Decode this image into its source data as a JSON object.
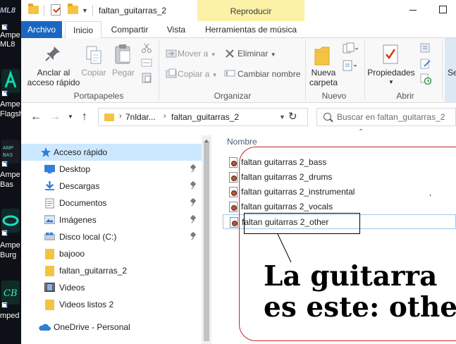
{
  "desktop": {
    "tiles": [
      {
        "label_top": "ML8",
        "label": "Ampe",
        "label2": "ML8",
        "color": "#3a3f52"
      },
      {
        "label": "Ampe",
        "label2": "Flagsh",
        "color": "#0e2a26"
      },
      {
        "label": "Ampe",
        "label2": "Bas",
        "color": "#1a1a22"
      },
      {
        "label": "Ampe",
        "label2": "Burg",
        "color": "#0f2b2a"
      },
      {
        "label": "mped",
        "label2": "",
        "color": "#0f2b26"
      }
    ]
  },
  "window": {
    "title": "faltan_guitarras_2",
    "context_tab": "Reproducir",
    "tabs": {
      "archivo": "Archivo",
      "inicio": "Inicio",
      "compartir": "Compartir",
      "vista": "Vista",
      "herramientas": "Herramientas de música"
    }
  },
  "ribbon": {
    "portapapeles": {
      "label": "Portapapeles",
      "anclar": "Anclar al",
      "anclar2": "acceso rápido",
      "copiar": "Copiar",
      "pegar": "Pegar"
    },
    "organizar": {
      "label": "Organizar",
      "mover": "Mover a",
      "copiar_a": "Copiar a",
      "eliminar": "Eliminar",
      "cambiar": "Cambiar nombre"
    },
    "nuevo": {
      "label": "Nuevo",
      "nueva": "Nueva",
      "carpeta": "carpeta"
    },
    "abrir": {
      "label": "Abrir",
      "propiedades": "Propiedades"
    },
    "cut_label": "Se"
  },
  "address": {
    "parts": [
      "7nldar...",
      "faltan_guitarras_2"
    ],
    "search_placeholder": "Buscar en faltan_guitarras_2"
  },
  "nav": {
    "items": [
      {
        "label": "Acceso rápido",
        "icon": "star-icon",
        "selected": true,
        "pinned": false
      },
      {
        "label": "Desktop",
        "icon": "desktop-icon",
        "pinned": true
      },
      {
        "label": "Descargas",
        "icon": "download-icon",
        "pinned": true
      },
      {
        "label": "Documentos",
        "icon": "document-icon",
        "pinned": true
      },
      {
        "label": "Imágenes",
        "icon": "image-icon",
        "pinned": true
      },
      {
        "label": "Disco local (C:)",
        "icon": "drive-icon",
        "pinned": true
      },
      {
        "label": "bajooo",
        "icon": "folder-icon",
        "pinned": false
      },
      {
        "label": "faltan_guitarras_2",
        "icon": "folder-icon",
        "pinned": false
      },
      {
        "label": "Videos",
        "icon": "video-icon",
        "pinned": false
      },
      {
        "label": "Videos listos 2",
        "icon": "folder-icon",
        "pinned": false
      },
      {
        "label": "OneDrive - Personal",
        "icon": "cloud-icon",
        "pinned": false
      }
    ]
  },
  "content": {
    "column_header": "Nombre",
    "files": [
      {
        "name": "faltan guitarras 2_bass"
      },
      {
        "name": "faltan guitarras 2_drums"
      },
      {
        "name": "faltan guitarras 2_instrumental"
      },
      {
        "name": "faltan guitarras 2_vocals"
      },
      {
        "name": "faltan guitarras 2_other"
      }
    ]
  },
  "annotation": {
    "line1": "La guitarra",
    "line2": "es este: other",
    "oval_color": "#c0282e"
  },
  "colors": {
    "accent": "#1a66c2",
    "context_tab": "#fbf2a8",
    "selection": "#cce8ff",
    "folder": "#f3c442"
  }
}
